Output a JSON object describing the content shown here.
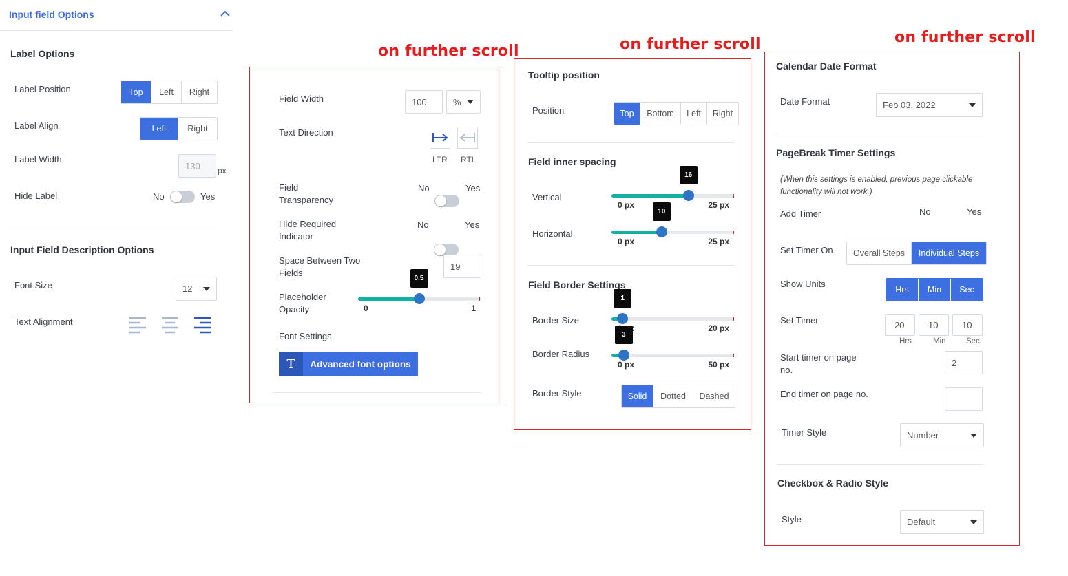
{
  "panel1": {
    "header": "Input field Options",
    "label_options": {
      "title": "Label Options",
      "position_label": "Label Position",
      "position_options": [
        "Top",
        "Left",
        "Right"
      ],
      "position_selected": "Top",
      "align_label": "Label Align",
      "align_options": [
        "Left",
        "Right"
      ],
      "align_selected": "Left",
      "width_label": "Label Width",
      "width_value": "130",
      "width_unit": "px",
      "hide_label": "Hide Label",
      "no": "No",
      "yes": "Yes",
      "hide_on": false
    },
    "desc_options": {
      "title": "Input Field Description Options",
      "font_size_label": "Font Size",
      "font_size_value": "12",
      "text_alignment_label": "Text Alignment",
      "alignment_icons": [
        "align-left-icon",
        "align-center-icon",
        "align-right-icon"
      ],
      "alignment_selected": "align-right-icon"
    }
  },
  "scroll_note": "on further scroll",
  "panel2": {
    "field_width_label": "Field Width",
    "field_width_value": "100",
    "field_width_unit": "%",
    "text_direction_label": "Text Direction",
    "ltr": "LTR",
    "rtl": "RTL",
    "transparency_label_1": "Field",
    "transparency_label_2": "Transparency",
    "hide_required_1": "Hide Required",
    "hide_required_2": "Indicator",
    "no": "No",
    "yes": "Yes",
    "space_label_1": "Space Between Two",
    "space_label_2": "Fields",
    "space_value": "19",
    "opacity_label_1": "Placeholder",
    "opacity_label_2": "Opacity",
    "opacity": {
      "value": 0.5,
      "min": "0",
      "max": "1",
      "tip": "0.5"
    },
    "font_settings_label": "Font Settings",
    "advanced_btn": "Advanced font options",
    "advanced_icon": "T"
  },
  "panel3": {
    "tooltip_title": "Tooltip position",
    "position_label": "Position",
    "position_options": [
      "Top",
      "Bottom",
      "Left",
      "Right"
    ],
    "position_selected": "Top",
    "spacing_title": "Field inner spacing",
    "vertical_label": "Vertical",
    "vertical": {
      "value": 16,
      "min": "0 px",
      "max": "25 px",
      "tip": "16"
    },
    "horizontal_label": "Horizontal",
    "horizontal": {
      "value": 10,
      "min": "0 px",
      "max": "25 px",
      "tip": "10"
    },
    "border_title": "Field Border Settings",
    "border_size_label": "Border Size",
    "border_size": {
      "value": 1,
      "min": "0 px",
      "max": "20 px",
      "tip": "1"
    },
    "border_radius_label": "Border Radius",
    "border_radius": {
      "value": 3,
      "min": "0 px",
      "max": "50 px",
      "tip": "3"
    },
    "border_style_label": "Border Style",
    "border_style_options": [
      "Solid",
      "Dotted",
      "Dashed"
    ],
    "border_style_selected": "Solid"
  },
  "panel4": {
    "calendar_title": "Calendar Date Format",
    "date_format_label": "Date Format",
    "date_format_value": "Feb 03, 2022",
    "pagebreak_title": "PageBreak Timer Settings",
    "pagebreak_note_1": "(When this settings is enabled, previous page clickable",
    "pagebreak_note_2": "functionality will not work.)",
    "add_timer_label": "Add Timer",
    "no": "No",
    "yes": "Yes",
    "add_timer_on": true,
    "set_timer_on_label": "Set Timer On",
    "set_timer_on_options": [
      "Overall Steps",
      "Individual Steps"
    ],
    "set_timer_on_selected": "Individual Steps",
    "show_units_label": "Show Units",
    "show_units_options": [
      "Hrs",
      "Min",
      "Sec"
    ],
    "set_timer_label": "Set Timer",
    "timer_values": [
      "20",
      "10",
      "10"
    ],
    "timer_units": [
      "Hrs",
      "Min",
      "Sec"
    ],
    "start_label_1": "Start timer on page",
    "start_label_2": "no.",
    "start_value": "2",
    "end_label": "End timer on page no.",
    "end_value": "",
    "timer_style_label": "Timer Style",
    "timer_style_value": "Number",
    "checkbox_title": "Checkbox & Radio Style",
    "style_label": "Style",
    "style_value": "Default"
  },
  "colors": {
    "accent": "#3d6fe0",
    "slider_fill": "#15b0a5",
    "slider_thumb": "#2f73c6",
    "note_red": "#e11d1d"
  }
}
